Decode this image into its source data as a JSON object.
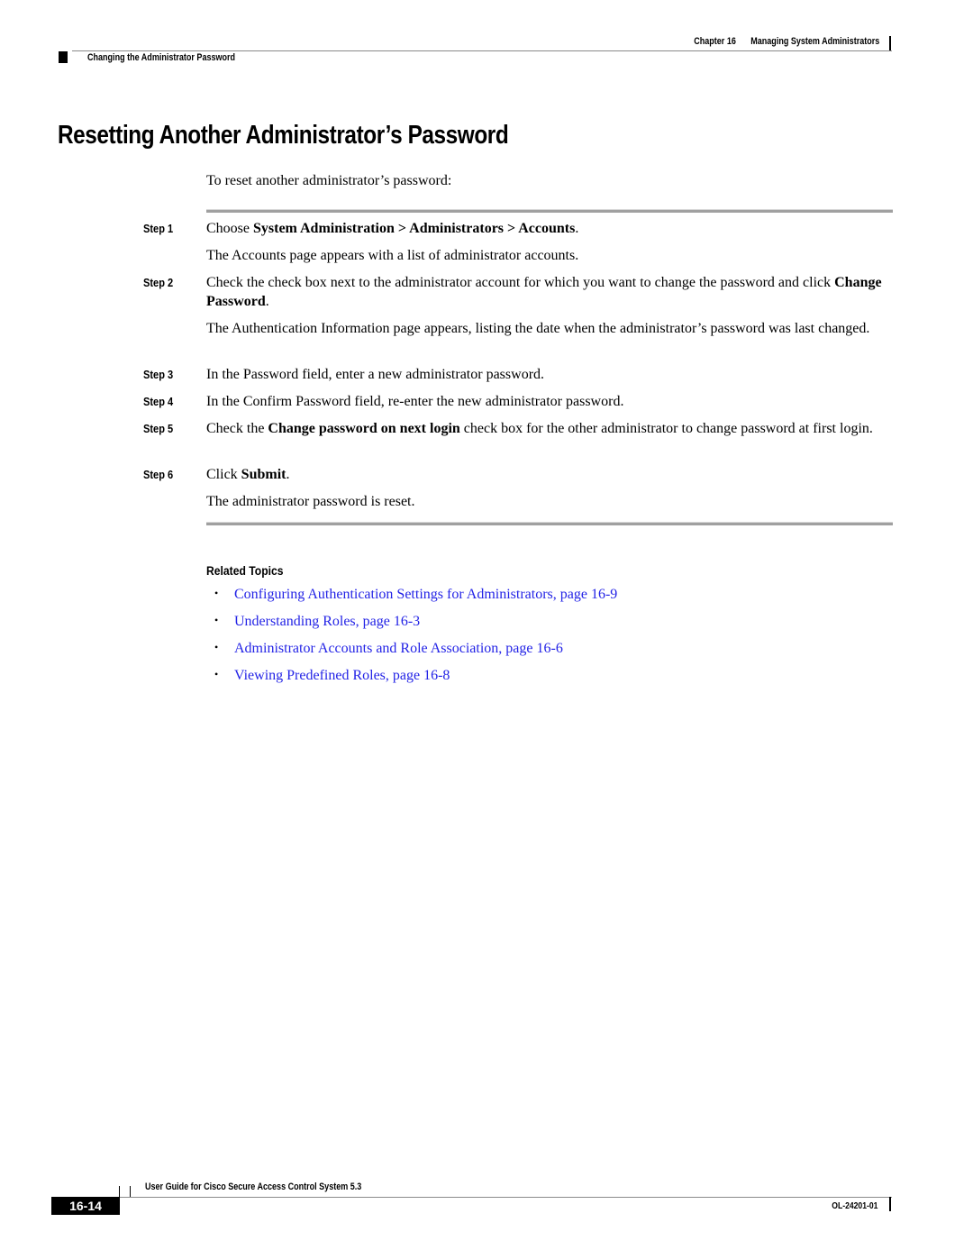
{
  "header": {
    "chapter": "Chapter 16",
    "chapter_title": "Managing System Administrators",
    "section": "Changing the Administrator Password"
  },
  "title": "Resetting Another Administrator’s Password",
  "intro": "To reset another administrator’s password:",
  "steps": [
    {
      "label": "Step 1",
      "text_parts": [
        "Choose ",
        "System Administration > Administrators > Accounts",
        "."
      ],
      "result": "The Accounts page appears with a list of administrator accounts."
    },
    {
      "label": "Step 2",
      "text_parts": [
        "Check the check box next to the administrator account for which you want to change the password and click ",
        "Change Password",
        "."
      ],
      "result": "The Authentication Information page appears, listing the date when the administrator’s password was last changed."
    },
    {
      "label": "Step 3",
      "text": "In the Password field, enter a new administrator password."
    },
    {
      "label": "Step 4",
      "text": "In the Confirm Password field, re-enter the new administrator password."
    },
    {
      "label": "Step 5",
      "text_parts": [
        "Check the ",
        "Change password on next login",
        " check box for the other administrator to change password at first login."
      ]
    },
    {
      "label": "Step 6",
      "text_parts": [
        "Click ",
        "Submit",
        "."
      ],
      "result": "The administrator password is reset."
    }
  ],
  "related_topics": {
    "heading": "Related Topics",
    "links": [
      "Configuring Authentication Settings for Administrators, page 16-9",
      "Understanding Roles, page 16-3",
      "Administrator Accounts and Role Association, page 16-6",
      "Viewing Predefined Roles, page 16-8"
    ],
    "bullet": "•",
    "link_color": "#2323e6"
  },
  "footer": {
    "guide_title": "User Guide for Cisco Secure Access Control System 5.3",
    "page_number": "16-14",
    "doc_number": "OL-24201-01"
  }
}
